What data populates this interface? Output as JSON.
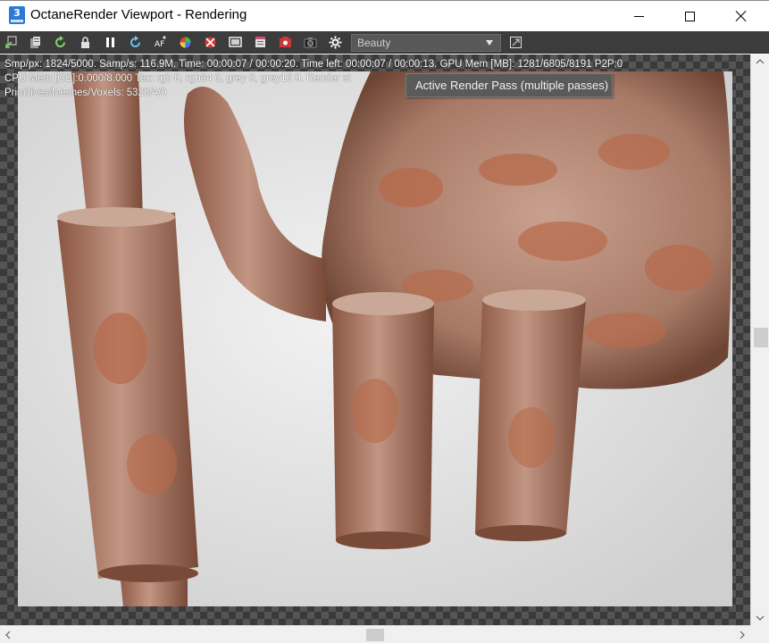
{
  "window": {
    "title": "OctaneRender Viewport - Rendering",
    "app_icon_label": "3"
  },
  "toolbar": {
    "icons": [
      "send-to-viewport-icon",
      "clipboard-icon",
      "restart-render-icon",
      "lock-icon",
      "pause-icon",
      "refresh-icon",
      "aperture-icon",
      "color-wheel-icon",
      "region-render-icon",
      "film-region-icon",
      "film-settings-icon",
      "render-layer-icon",
      "camera-icon",
      "settings-icon"
    ],
    "render_pass_value": "Beauty",
    "tooltip": "Active Render Pass (multiple passes)"
  },
  "stats": {
    "line1": "Smp/px: 1824/5000.   Samp/s: 116.9M.   Time: 00:00:07 / 00:00:20.   Time left: 00:00:07 / 00:00:13.   GPU Mem [MB]: 1281/6805/8191 P2P:0",
    "line2": "CPU Mem [GB]:0.000/8.000   Tex: rgb 0, rgb64 0, grey 0, grey16 0.   Render st",
    "line3": "Primitives/Meshes/Voxels: 5328/4/0"
  },
  "colors": {
    "toolbar_bg": "#3c3c3c",
    "terracotta": "#b76a4a",
    "beige": "#cdb8ad",
    "backdrop": "#e8e8e8"
  }
}
